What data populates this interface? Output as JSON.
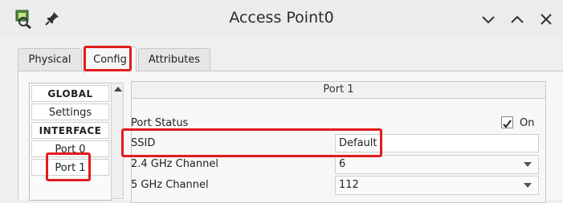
{
  "window": {
    "title": "Access Point0"
  },
  "icons": {
    "app": "packet-tracer-app-icon",
    "pin": "pin-icon",
    "minimize": "chevron-down-icon",
    "maximize": "chevron-up-icon",
    "close": "close-icon"
  },
  "tabs": [
    {
      "label": "Physical",
      "active": false
    },
    {
      "label": "Config",
      "active": true
    },
    {
      "label": "Attributes",
      "active": false
    }
  ],
  "nav": {
    "items": [
      {
        "label": "GLOBAL",
        "type": "header"
      },
      {
        "label": "Settings",
        "type": "item"
      },
      {
        "label": "INTERFACE",
        "type": "header"
      },
      {
        "label": "Port 0",
        "type": "item"
      },
      {
        "label": "Port 1",
        "type": "item",
        "selected": true
      }
    ]
  },
  "panel": {
    "header": "Port 1",
    "port_status_label": "Port Status",
    "port_status_checkbox_label": "On",
    "port_status_checked": true,
    "ssid_label": "SSID",
    "ssid_value": "Default",
    "channel_24_label": "2.4 GHz Channel",
    "channel_24_value": "6",
    "channel_5_label": "5 GHz Channel",
    "channel_5_value": "112"
  },
  "colors": {
    "highlight": "#e31b1b"
  }
}
